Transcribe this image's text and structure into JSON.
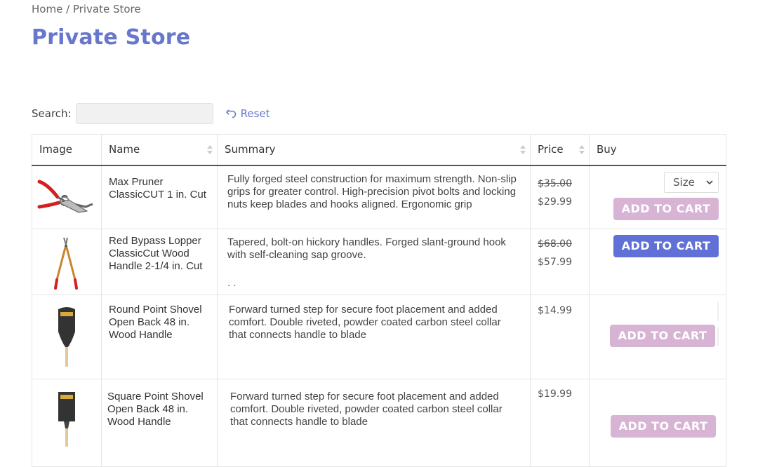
{
  "breadcrumb": {
    "home": "Home",
    "separator": " / ",
    "current": "Private Store"
  },
  "page_title": "Private Store",
  "search": {
    "label": "Search:",
    "value": "",
    "reset_label": "Reset"
  },
  "table": {
    "headers": {
      "image": "Image",
      "name": "Name",
      "summary": "Summary",
      "price": "Price",
      "buy": "Buy"
    },
    "rows": [
      {
        "name": "Max Pruner ClassicCUT 1 in. Cut",
        "summary": "Fully forged steel construction for maximum strength. Non-slip grips for greater control. High-precision pivot bolts and locking nuts keep blades and hooks aligned. Ergonomic grip",
        "old_price": "$35.00",
        "price": "$29.99",
        "size_label": "Size",
        "button": "ADD TO CART",
        "image_icon": "pruner-icon"
      },
      {
        "name": "Red Bypass Lopper ClassicCut Wood Handle 2-1/4 in. Cut",
        "summary": "Tapered, bolt-on hickory handles. Forged slant-ground hook with self-cleaning sap groove.",
        "summary_extra": ". .",
        "old_price": "$68.00",
        "price": "$57.99",
        "button": "ADD TO CART",
        "image_icon": "lopper-icon"
      },
      {
        "name": "Round Point Shovel Open Back 48 in. Wood Handle",
        "summary": "Forward turned step for secure foot placement and added comfort. Double riveted, powder coated carbon steel collar that connects handle to blade",
        "price": "$14.99",
        "button": "ADD TO CART",
        "image_icon": "round-shovel-icon"
      },
      {
        "name": "Square Point Shovel Open Back 48 in. Wood Handle",
        "summary": "Forward turned step for secure foot placement and added comfort. Double riveted, powder coated carbon steel collar that connects handle to blade",
        "price": "$19.99",
        "button": "ADD TO CART",
        "image_icon": "square-shovel-icon"
      }
    ]
  },
  "colors": {
    "accent": "#6677cc",
    "button_active": "#6170d6",
    "button_disabled": "#d8b4d4"
  }
}
